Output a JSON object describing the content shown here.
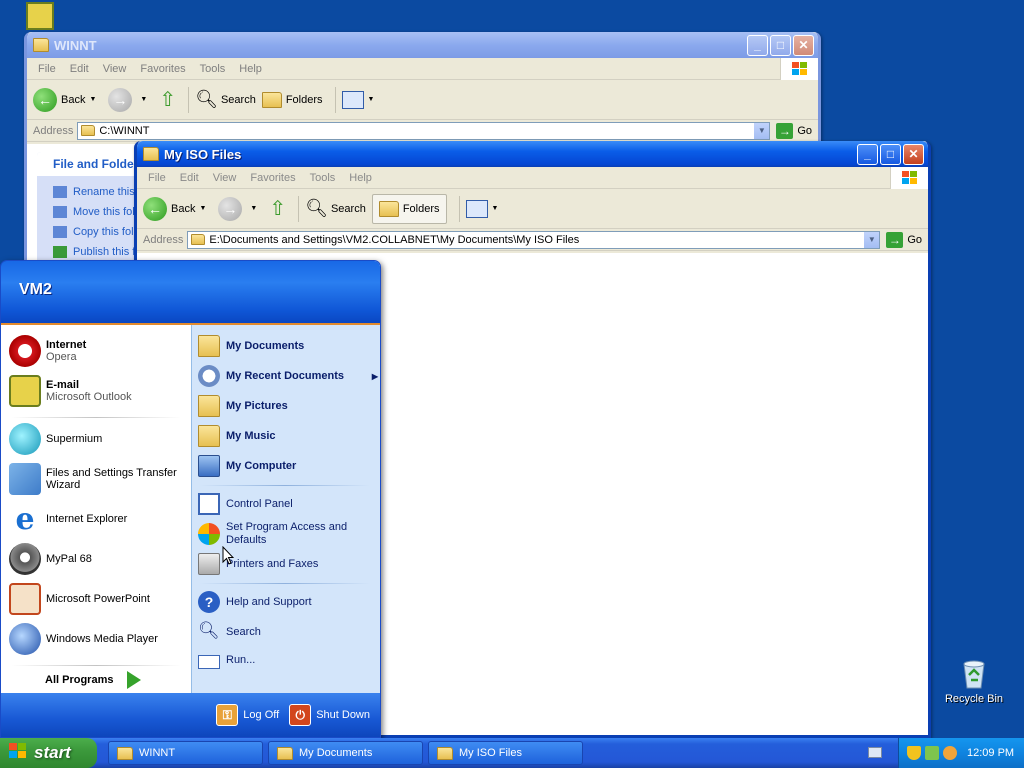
{
  "desktop": {
    "recycle_bin_label": "Recycle Bin"
  },
  "winnt_window": {
    "title": "WINNT",
    "menu": [
      "File",
      "Edit",
      "View",
      "Favorites",
      "Tools",
      "Help"
    ],
    "toolbar": {
      "back": "Back",
      "search": "Search",
      "folders": "Folders"
    },
    "address_label": "Address",
    "address_value": "C:\\WINNT",
    "go_label": "Go",
    "taskpane_title": "File and Folder Tasks",
    "tasks": [
      "Rename this folder",
      "Move this folder",
      "Copy this folder",
      "Publish this folder"
    ]
  },
  "iso_window": {
    "title": "My ISO Files",
    "menu": [
      "File",
      "Edit",
      "View",
      "Favorites",
      "Tools",
      "Help"
    ],
    "toolbar": {
      "back": "Back",
      "search": "Search",
      "folders": "Folders"
    },
    "address_label": "Address",
    "address_value": "E:\\Documents and Settings\\VM2.COLLABNET\\My Documents\\My ISO Files",
    "go_label": "Go"
  },
  "start_menu": {
    "user": "VM2",
    "pinned": [
      {
        "title": "Internet",
        "subtitle": "Opera"
      },
      {
        "title": "E-mail",
        "subtitle": "Microsoft Outlook"
      }
    ],
    "recent": [
      "Supermium",
      "Files and Settings Transfer Wizard",
      "Internet Explorer",
      "MyPal 68",
      "Microsoft PowerPoint",
      "Windows Media Player"
    ],
    "all_programs": "All Programs",
    "places": {
      "my_documents": "My Documents",
      "my_recent_documents": "My Recent Documents",
      "my_pictures": "My Pictures",
      "my_music": "My Music",
      "my_computer": "My Computer",
      "control_panel": "Control Panel",
      "set_program_access": "Set Program Access and Defaults",
      "printers": "Printers and Faxes",
      "help": "Help and Support",
      "search": "Search",
      "run": "Run..."
    },
    "log_off": "Log Off",
    "shut_down": "Shut Down"
  },
  "taskbar": {
    "start_label": "start",
    "tasks": [
      "WINNT",
      "My Documents",
      "My ISO Files"
    ],
    "clock": "12:09 PM"
  },
  "colors": {
    "desktop": "#0b4aa1",
    "title_active": "#0a5de8",
    "start_green": "#3c9a3c"
  }
}
